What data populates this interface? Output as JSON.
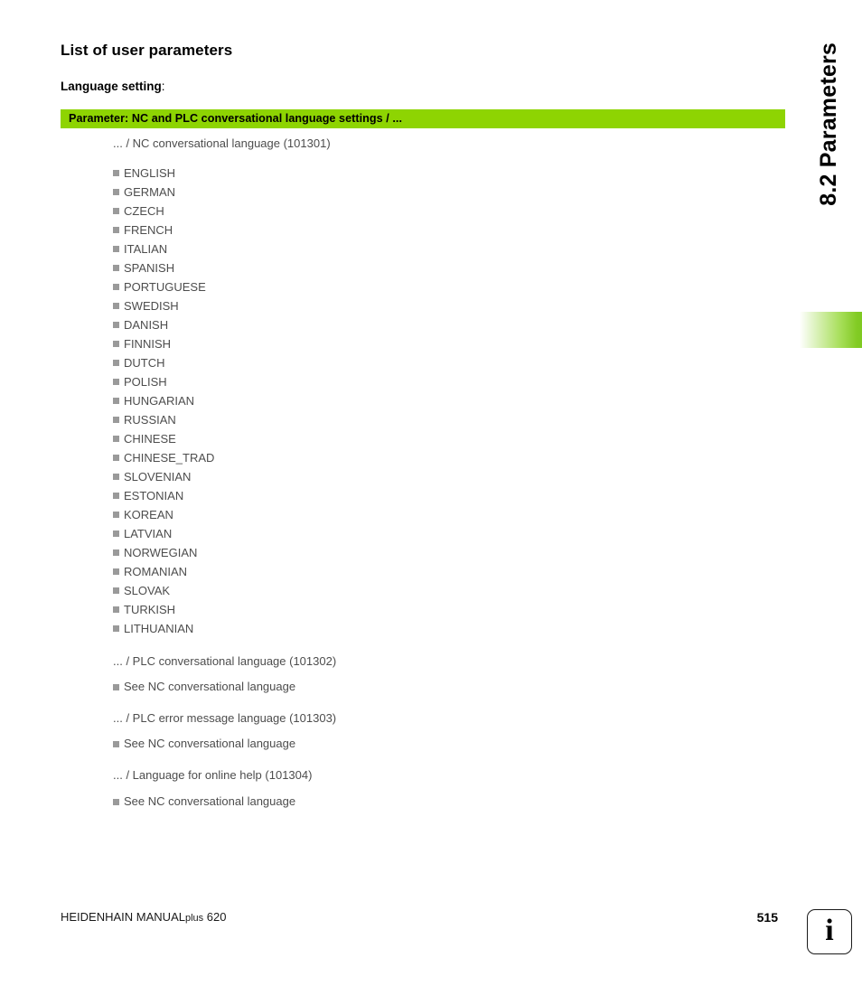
{
  "chapter": {
    "label": "8.2 Parameters"
  },
  "heading": {
    "title": "List of user parameters",
    "subsection": "Language setting",
    "subsection_colon": ":"
  },
  "parameter_banner": {
    "text": "Parameter: NC and PLC conversational language settings / ...",
    "background_color": "#8ed402",
    "text_color": "#000000"
  },
  "nc_language": {
    "path": "... / NC conversational language (101301)",
    "options": [
      "ENGLISH",
      "GERMAN",
      "CZECH",
      "FRENCH",
      "ITALIAN",
      "SPANISH",
      "PORTUGUESE",
      "SWEDISH",
      "DANISH",
      "FINNISH",
      "DUTCH",
      "POLISH",
      "HUNGARIAN",
      "RUSSIAN",
      "CHINESE",
      "CHINESE_TRAD",
      "SLOVENIAN",
      "ESTONIAN",
      "KOREAN",
      "LATVIAN",
      "NORWEGIAN",
      "ROMANIAN",
      "SLOVAK",
      "TURKISH",
      "LITHUANIAN"
    ]
  },
  "sub_parameters": [
    {
      "path": "... / PLC conversational language (101302)",
      "note": "See NC conversational language"
    },
    {
      "path": "... / PLC error message language (101303)",
      "note": "See NC conversational language"
    },
    {
      "path": "... / Language for online help (101304)",
      "note": "See NC conversational language"
    }
  ],
  "footer": {
    "product_prefix": "HEIDENHAIN MANUAL",
    "product_plus": "plus",
    "product_suffix": " 620",
    "page_number": "515",
    "info_glyph": "i"
  },
  "colors": {
    "accent_green": "#8ed402",
    "bullet_gray": "#9a9a9a",
    "body_text": "#4d4d4d"
  }
}
